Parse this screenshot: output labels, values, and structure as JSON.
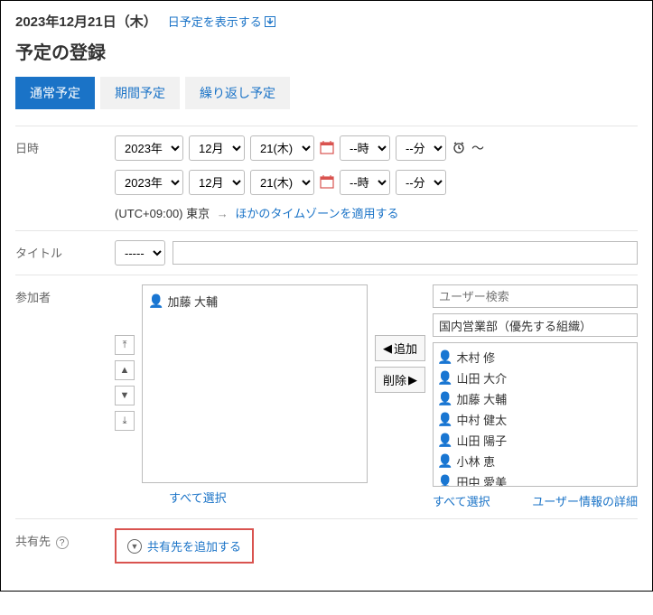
{
  "header": {
    "date_text": "2023年12月21日（木）",
    "show_day_link": "日予定を表示する"
  },
  "page_title": "予定の登録",
  "tabs": [
    {
      "label": "通常予定",
      "active": true
    },
    {
      "label": "期間予定",
      "active": false
    },
    {
      "label": "繰り返し予定",
      "active": false
    }
  ],
  "labels": {
    "datetime": "日時",
    "title": "タイトル",
    "participants": "参加者",
    "share": "共有先"
  },
  "datetime": {
    "start": {
      "year": "2023年",
      "month": "12月",
      "day": "21(木)",
      "hour": "--時",
      "minute": "--分"
    },
    "end": {
      "year": "2023年",
      "month": "12月",
      "day": "21(木)",
      "hour": "--時",
      "minute": "--分"
    },
    "tz_text": "(UTC+09:00) 東京",
    "tz_link": "ほかのタイムゾーンを適用する",
    "tilde": "～"
  },
  "title_select": "-----",
  "participants": {
    "selected": [
      {
        "name": "加藤 大輔"
      }
    ],
    "add_btn": "追加",
    "remove_btn": "削除",
    "search_placeholder": "ユーザー検索",
    "org_label": "国内営業部（優先する組織）",
    "candidates": [
      {
        "name": "木村 修"
      },
      {
        "name": "山田 大介"
      },
      {
        "name": "加藤 大輔"
      },
      {
        "name": "中村 健太"
      },
      {
        "name": "山田 陽子"
      },
      {
        "name": "小林 恵"
      },
      {
        "name": "田中 愛美"
      }
    ],
    "select_all": "すべて選択",
    "user_detail": "ユーザー情報の詳細"
  },
  "share": {
    "add_link": "共有先を追加する"
  }
}
